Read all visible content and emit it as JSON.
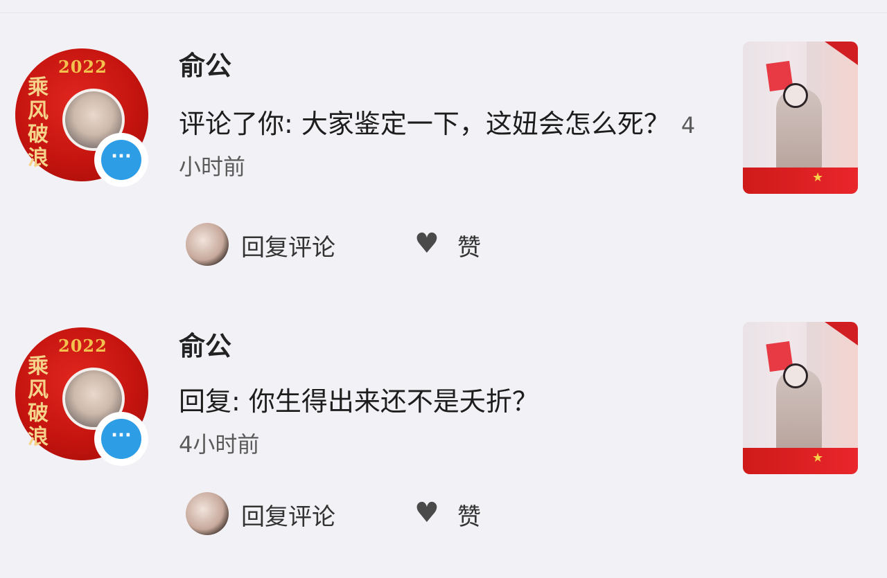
{
  "items": [
    {
      "username": "俞公",
      "avatar_year": "2022",
      "avatar_calligraphy": "乘风破浪",
      "comment": "评论了你: 大家鉴定一下，这妞会怎么死？",
      "time": "4小时前",
      "reply_label": "回复评论",
      "like_label": "赞"
    },
    {
      "username": "俞公",
      "avatar_year": "2022",
      "avatar_calligraphy": "乘风破浪",
      "comment": "回复: 你生得出来还不是夭折？",
      "time": "4小时前",
      "reply_label": "回复评论",
      "like_label": "赞"
    }
  ],
  "icons": {
    "badge": "chat-bubble-icon",
    "like": "heart-icon"
  },
  "colors": {
    "background": "#f2f2f6",
    "badge": "#2d9de6",
    "avatar_red": "#c5140f"
  }
}
